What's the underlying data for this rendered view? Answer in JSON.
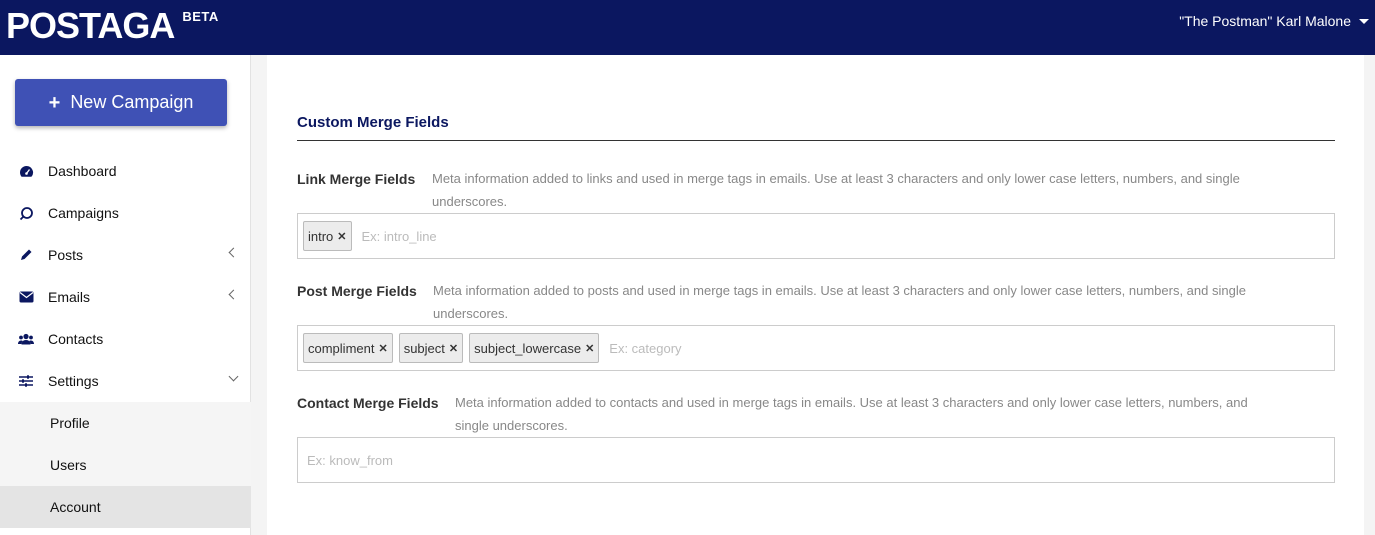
{
  "header": {
    "logo": "POSTAGA",
    "beta": "BETA",
    "user": "\"The Postman\" Karl Malone"
  },
  "sidebar": {
    "new_campaign": "New Campaign",
    "items": [
      {
        "label": "Dashboard",
        "icon": "dashboard-icon"
      },
      {
        "label": "Campaigns",
        "icon": "campaigns-icon"
      },
      {
        "label": "Posts",
        "icon": "pencil-icon"
      },
      {
        "label": "Emails",
        "icon": "envelope-icon"
      },
      {
        "label": "Contacts",
        "icon": "users-icon"
      },
      {
        "label": "Settings",
        "icon": "sliders-icon"
      }
    ],
    "settings_sub": [
      "Profile",
      "Users",
      "Account"
    ]
  },
  "main": {
    "section_title": "Custom Merge Fields",
    "link_fields": {
      "label": "Link Merge Fields",
      "help": "Meta information added to links and used in merge tags in emails. Use at least 3 characters and only lower case letters, numbers, and single underscores.",
      "tags": [
        "intro"
      ],
      "placeholder": "Ex: intro_line"
    },
    "post_fields": {
      "label": "Post Merge Fields",
      "help": "Meta information added to posts and used in merge tags in emails. Use at least 3 characters and only lower case letters, numbers, and single underscores.",
      "tags": [
        "compliment",
        "subject",
        "subject_lowercase"
      ],
      "placeholder": "Ex: category"
    },
    "contact_fields": {
      "label": "Contact Merge Fields",
      "help": "Meta information added to contacts and used in merge tags in emails. Use at least 3 characters and only lower case letters, numbers, and single underscores.",
      "tags": [],
      "placeholder": "Ex: know_from"
    }
  }
}
